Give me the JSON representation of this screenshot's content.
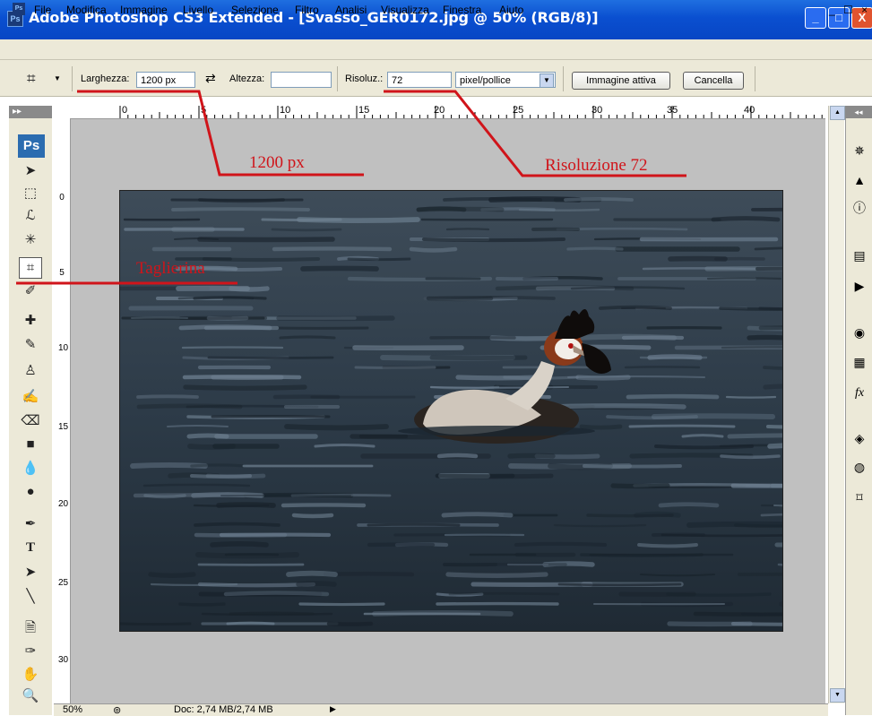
{
  "window": {
    "title": "Adobe Photoshop CS3 Extended - [Svasso_GER0172.jpg @ 50% (RGB/8)]",
    "ps_logo": "Ps",
    "min": "_",
    "max": "□",
    "close": "X"
  },
  "menu": {
    "items": [
      "File",
      "Modifica",
      "Immagine",
      "Livello",
      "Selezione",
      "Filtro",
      "Analisi",
      "Visualizza",
      "Finestra",
      "Aiuto"
    ],
    "doc_controls": "_ ☐ ×"
  },
  "options": {
    "width_label": "Larghezza:",
    "width_value": "1200 px",
    "height_label": "Altezza:",
    "height_value": "",
    "resolution_label": "Risoluz.:",
    "resolution_value": "72",
    "unit_value": "pixel/pollice",
    "active_image_button": "Immagine attiva",
    "clear_button": "Cancella"
  },
  "ruler": {
    "top_labels": [
      "0",
      "5",
      "10",
      "15",
      "20",
      "25",
      "30",
      "35",
      "40"
    ],
    "left_labels": [
      "0",
      "5",
      "10",
      "15",
      "20",
      "25",
      "30"
    ]
  },
  "toolbox": {
    "header": "▸▸",
    "ps_badge": "Ps"
  },
  "annotations": {
    "width_note": "1200 px",
    "resolution_note": "Risoluzione 72",
    "tool_note": "Taglierina"
  },
  "status": {
    "zoom": "50%",
    "doc": "Doc: 2,74 MB/2,74 MB"
  },
  "colors": {
    "title_bar": "#0a4fd0",
    "annotation": "#d0141a",
    "canvas_bg": "#c0c0c0"
  }
}
